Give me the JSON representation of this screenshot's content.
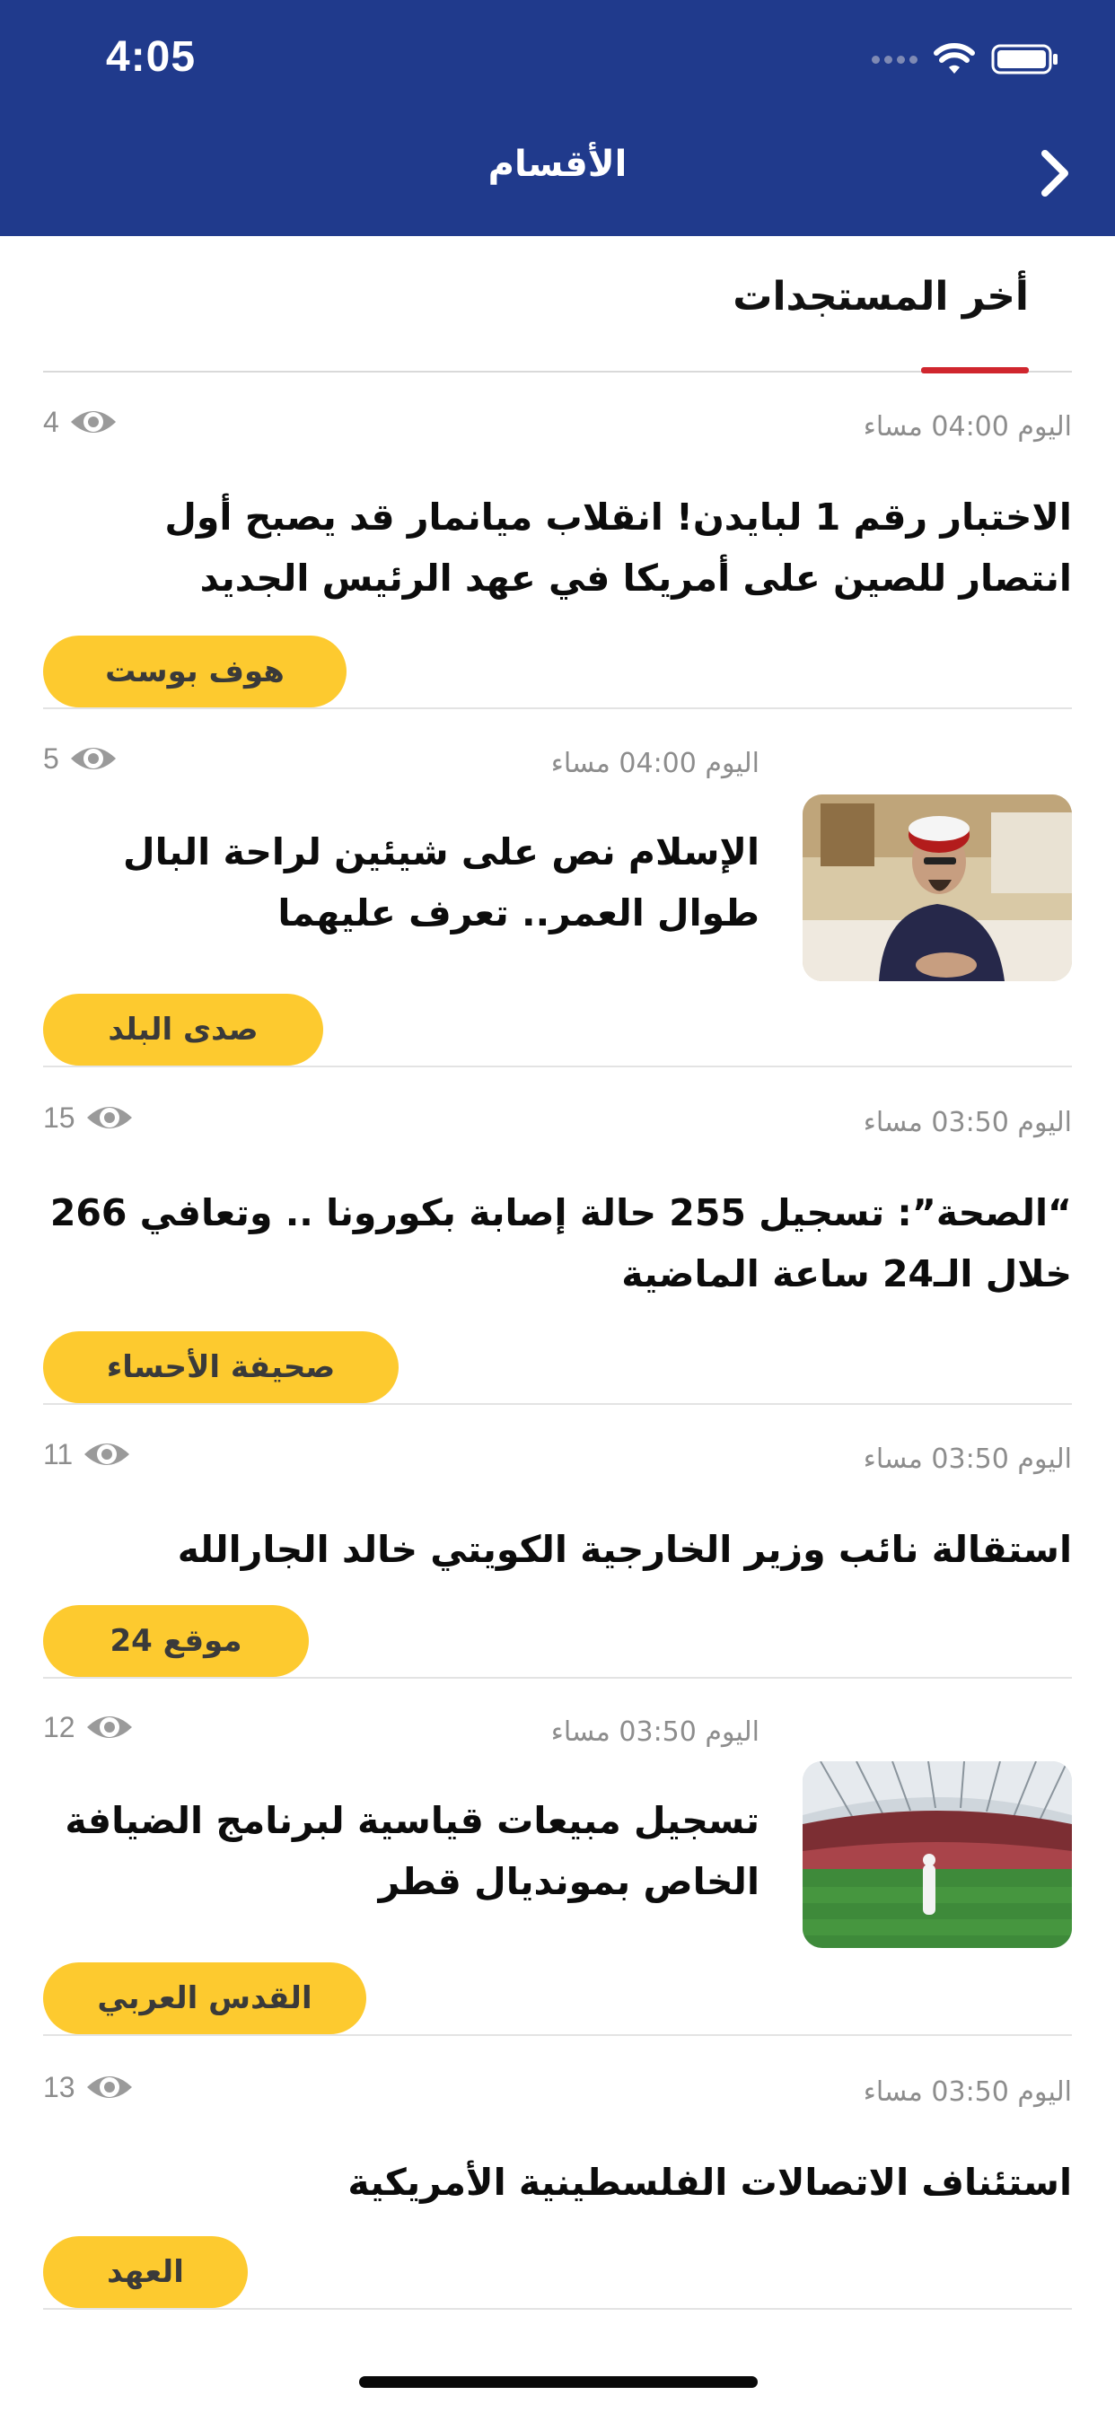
{
  "status_bar": {
    "time": "4:05"
  },
  "header": {
    "title": "الأقسام"
  },
  "tabs": [
    {
      "label": "أخر المستجدات",
      "active": true
    }
  ],
  "colors": {
    "header_bg": "#203a8c",
    "tab_underline": "#d0262e",
    "source_chip": "#fdca2f"
  },
  "articles": [
    {
      "time": "اليوم 04:00 مساء",
      "views": "4",
      "headline": "الاختبار رقم 1 لبايدن! انقلاب ميانمار قد يصبح أول انتصار للصين على أمريكا في عهد الرئيس الجديد",
      "source": "هوف بوست",
      "has_image": false
    },
    {
      "time": "اليوم 04:00 مساء",
      "views": "5",
      "headline": "الإسلام نص على شيئين لراحة البال طوال العمر.. تعرف عليهما",
      "source": "صدى البلد",
      "has_image": true,
      "image": "cleric-portrait"
    },
    {
      "time": "اليوم 03:50 مساء",
      "views": "15",
      "headline": "“الصحة”: تسجيل 255 حالة إصابة بكورونا .. وتعافي 266 خلال الـ24 ساعة الماضية",
      "source": "صحيفة الأحساء",
      "has_image": false
    },
    {
      "time": "اليوم 03:50 مساء",
      "views": "11",
      "headline": "استقالة نائب وزير الخارجية الكويتي خالد الجارالله",
      "source": "موقع 24",
      "has_image": false
    },
    {
      "time": "اليوم 03:50 مساء",
      "views": "12",
      "headline": "تسجيل مبيعات قياسية لبرنامج الضيافة الخاص بمونديال قطر",
      "source": "القدس العربي",
      "has_image": true,
      "image": "stadium"
    },
    {
      "time": "اليوم 03:50 مساء",
      "views": "13",
      "headline": "استئناف الاتصالات الفلسطينية الأمريكية",
      "source": "العهد",
      "has_image": false
    }
  ]
}
